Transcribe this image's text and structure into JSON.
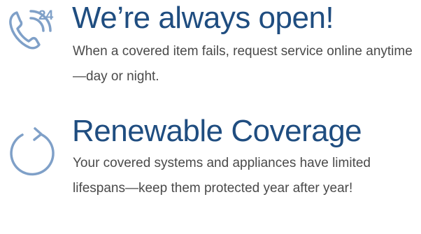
{
  "colors": {
    "title": "#1f4d80",
    "body": "#4a4a4a",
    "icon": "#7fa0c8"
  },
  "features": [
    {
      "icon": "phone-24-hours-icon",
      "icon_badge": "24",
      "title": "We’re always open!",
      "description": "When a covered item fails, request service online anytime—day or night."
    },
    {
      "icon": "refresh-cycle-icon",
      "title": "Renewable Coverage",
      "description": "Your covered systems and appliances have limited lifespans—keep them protected year after year!"
    }
  ]
}
